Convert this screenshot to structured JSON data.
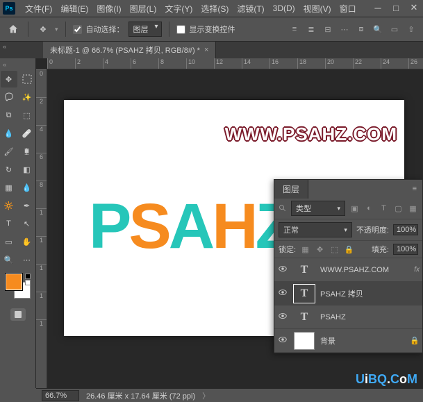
{
  "app_logo": "Ps",
  "menu": [
    "文件(F)",
    "编辑(E)",
    "图像(I)",
    "图层(L)",
    "文字(Y)",
    "选择(S)",
    "滤镜(T)",
    "3D(D)",
    "视图(V)",
    "窗口"
  ],
  "options": {
    "auto_select": "自动选择：",
    "target": "图层",
    "show_transform": "显示变换控件"
  },
  "document_tab": "未标题-1 @ 66.7% (PSAHZ 拷贝, RGB/8#) *",
  "ruler_h": [
    "0",
    "2",
    "4",
    "6",
    "8",
    "10",
    "12",
    "14",
    "16",
    "18",
    "20",
    "22",
    "24",
    "26"
  ],
  "ruler_v": [
    "0",
    "2",
    "4",
    "6",
    "8",
    "1",
    "1",
    "1",
    "1",
    "1"
  ],
  "canvas": {
    "url": "WWW.PSAHZ.COM",
    "text": "PSAHZ"
  },
  "status": {
    "zoom": "66.7%",
    "dims": "26.46 厘米 x 17.64 厘米 (72 ppi)"
  },
  "layers_panel": {
    "title": "图层",
    "type_label": "类型",
    "blend": "正常",
    "opacity_label": "不透明度:",
    "opacity": "100%",
    "lock_label": "锁定:",
    "fill_label": "填充:",
    "fill": "100%",
    "layers": [
      {
        "name": "WWW.PSAHZ.COM",
        "type": "T",
        "fx": "fx"
      },
      {
        "name": "PSAHZ 拷贝",
        "type": "T",
        "selected": true
      },
      {
        "name": "PSAHZ",
        "type": "T"
      },
      {
        "name": "背景",
        "type": "bg",
        "locked": true
      }
    ]
  },
  "watermark": {
    "u": "U",
    "i": "i",
    "b": "B",
    "q": "Q",
    "dot": ".",
    "c": "C",
    "o": "o",
    "m": "M"
  }
}
